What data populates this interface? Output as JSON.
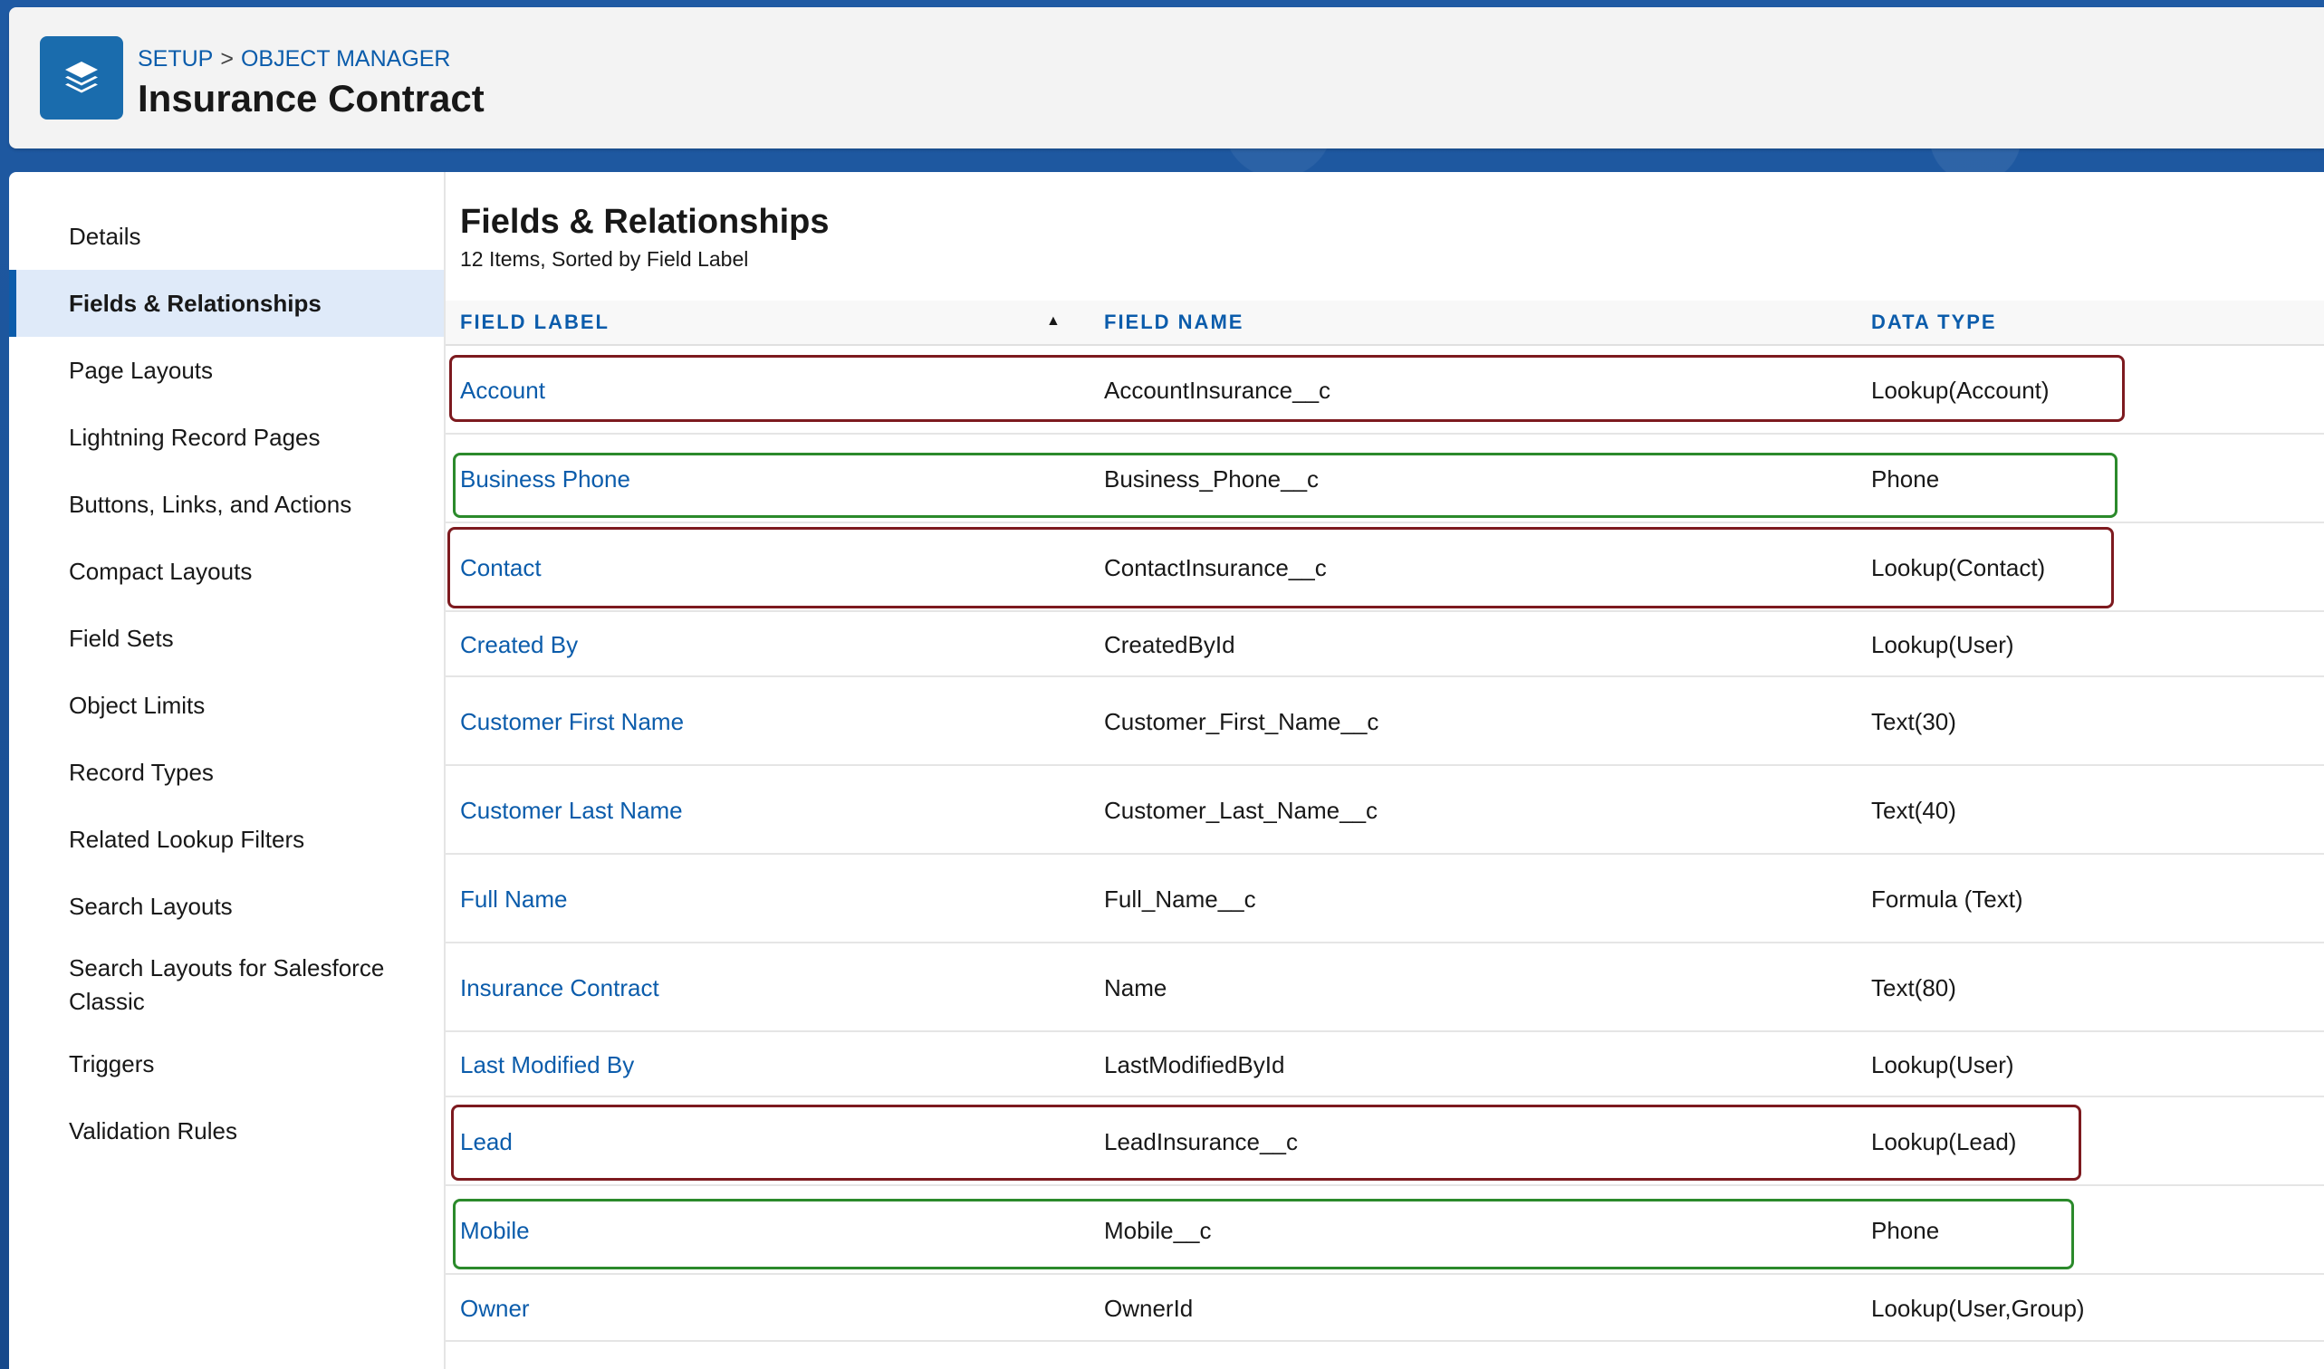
{
  "header": {
    "breadcrumb": [
      "SETUP",
      "OBJECT MANAGER"
    ],
    "breadcrumb_separator": ">",
    "title": "Insurance Contract",
    "icon": "layers-icon"
  },
  "sidebar": {
    "items": [
      {
        "label": "Details"
      },
      {
        "label": "Fields & Relationships",
        "active": true
      },
      {
        "label": "Page Layouts"
      },
      {
        "label": "Lightning Record Pages"
      },
      {
        "label": "Buttons, Links, and Actions"
      },
      {
        "label": "Compact Layouts"
      },
      {
        "label": "Field Sets"
      },
      {
        "label": "Object Limits"
      },
      {
        "label": "Record Types"
      },
      {
        "label": "Related Lookup Filters"
      },
      {
        "label": "Search Layouts"
      },
      {
        "label": "Search Layouts for Salesforce Classic"
      },
      {
        "label": "Triggers"
      },
      {
        "label": "Validation Rules"
      }
    ]
  },
  "main": {
    "title": "Fields & Relationships",
    "subtitle": "12 Items, Sorted by Field Label",
    "columns": [
      "FIELD LABEL",
      "FIELD NAME",
      "DATA TYPE"
    ],
    "sort_icon": "sort-ascending-icon",
    "rows": [
      {
        "label": "Account",
        "name": "AccountInsurance__c",
        "type": "Lookup(Account)",
        "highlight": "red"
      },
      {
        "label": "Business Phone",
        "name": "Business_Phone__c",
        "type": "Phone",
        "highlight": "green"
      },
      {
        "label": "Contact",
        "name": "ContactInsurance__c",
        "type": "Lookup(Contact)",
        "highlight": "red"
      },
      {
        "label": "Created By",
        "name": "CreatedById",
        "type": "Lookup(User)"
      },
      {
        "label": "Customer First Name",
        "name": "Customer_First_Name__c",
        "type": "Text(30)"
      },
      {
        "label": "Customer Last Name",
        "name": "Customer_Last_Name__c",
        "type": "Text(40)"
      },
      {
        "label": "Full Name",
        "name": "Full_Name__c",
        "type": "Formula (Text)"
      },
      {
        "label": "Insurance Contract",
        "name": "Name",
        "type": "Text(80)"
      },
      {
        "label": "Last Modified By",
        "name": "LastModifiedById",
        "type": "Lookup(User)"
      },
      {
        "label": "Lead",
        "name": "LeadInsurance__c",
        "type": "Lookup(Lead)",
        "highlight": "red"
      },
      {
        "label": "Mobile",
        "name": "Mobile__c",
        "type": "Phone",
        "highlight": "green"
      },
      {
        "label": "Owner",
        "name": "OwnerId",
        "type": "Lookup(User,Group)"
      }
    ]
  },
  "colors": {
    "link": "#0b5cab",
    "highlight_red": "#7d1a1f",
    "highlight_green": "#2b8a2b",
    "active_nav_bg": "#dfeaf9"
  }
}
